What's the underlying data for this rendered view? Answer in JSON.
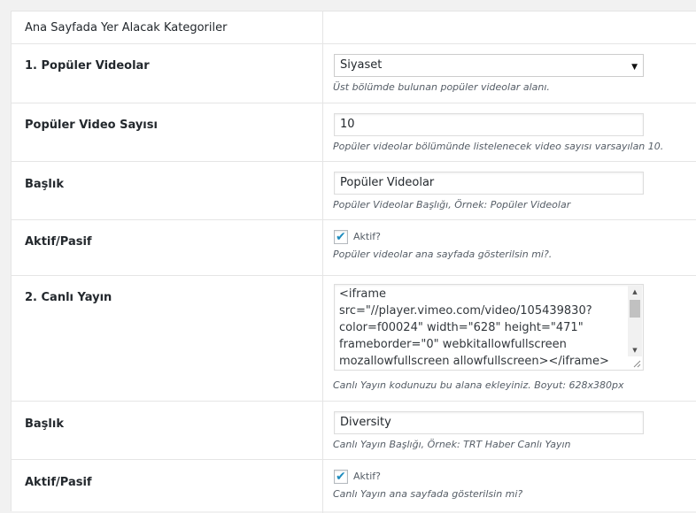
{
  "section": {
    "title": "Ana Sayfada Yer Alacak Kategoriler"
  },
  "popular_videos": {
    "label": "1. Popüler Videolar",
    "selected": "Siyaset",
    "description": "Üst bölümde bulunan popüler videolar alanı."
  },
  "video_count": {
    "label": "Popüler Video Sayısı",
    "value": "10",
    "description": "Popüler videolar bölümünde listelenecek video sayısı varsayılan 10."
  },
  "popular_title": {
    "label": "Başlık",
    "value": "Popüler Videolar",
    "description": "Popüler Videolar Başlığı, Örnek: Popüler Videolar"
  },
  "popular_active": {
    "label": "Aktif/Pasif",
    "checkbox_label": "Aktif?",
    "checked": true,
    "description": "Popüler videolar ana sayfada gösterilsin mi?."
  },
  "live": {
    "label": "2. Canlı Yayın",
    "code_lines": [
      "<iframe",
      "src=\"//player.vimeo.com/video/105439830?",
      "color=f00024\" width=\"628\" height=\"471\"",
      "frameborder=\"0\" webkitallowfullscreen",
      "mozallowfullscreen allowfullscreen></iframe>"
    ],
    "description": "Canlı Yayın kodunuzu bu alana ekleyiniz. Boyut: 628x380px"
  },
  "live_title": {
    "label": "Başlık",
    "value": "Diversity",
    "description": "Canlı Yayın Başlığı, Örnek: TRT Haber Canlı Yayın"
  },
  "live_active": {
    "label": "Aktif/Pasif",
    "checkbox_label": "Aktif?",
    "checked": true,
    "description": "Canlı Yayın ana sayfada gösterilsin mi?"
  },
  "icons": {
    "select_arrow": "triangle-down",
    "checkbox": "checkmark",
    "scroll_up": "triangle-up",
    "scroll_down": "triangle-down",
    "resize": "diagonal-grip"
  },
  "colors": {
    "check": "#1e8cbe",
    "description": "#555d66"
  }
}
